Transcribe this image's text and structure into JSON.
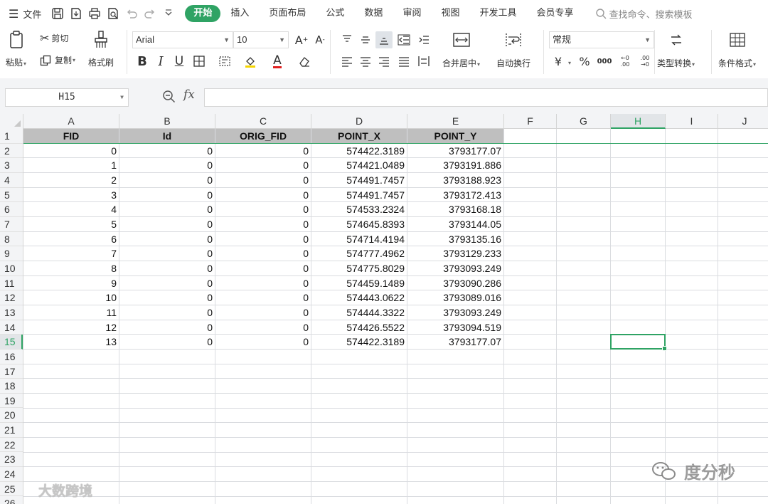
{
  "menu": {
    "file_label": "文件",
    "tabs": [
      "开始",
      "插入",
      "页面布局",
      "公式",
      "数据",
      "审阅",
      "视图",
      "开发工具",
      "会员专享"
    ],
    "active_tab": "开始",
    "search_placeholder": "查找命令、搜索模板"
  },
  "ribbon": {
    "paste": "粘贴",
    "cut": "剪切",
    "copy": "复制",
    "format_painter": "格式刷",
    "font_name": "Arial",
    "font_size": "10",
    "merge_center": "合并居中",
    "wrap_text": "自动换行",
    "number_format": "常规",
    "type_convert": "类型转换",
    "conditional_format": "条件格式",
    "currency_symbol": "¥",
    "percent_symbol": "%",
    "thousands_symbol": "000",
    "inc_decimal": "←0 .00",
    "dec_decimal": ".00 →0"
  },
  "formula_bar": {
    "name_box": "H15",
    "fx_label": "fx",
    "formula": ""
  },
  "sheet": {
    "columns": [
      "A",
      "B",
      "C",
      "D",
      "E",
      "F",
      "G",
      "H",
      "I",
      "J"
    ],
    "selected_column": "H",
    "selected_cell": "H15",
    "row_numbers": [
      "1",
      "2",
      "3",
      "4",
      "5",
      "6",
      "7",
      "8",
      "9",
      "10",
      "11",
      "12",
      "13",
      "14",
      "15",
      "16",
      "17",
      "18",
      "19",
      "20",
      "21",
      "22",
      "23",
      "24",
      "25",
      "26"
    ],
    "headers": [
      "FID",
      "Id",
      "ORIG_FID",
      "POINT_X",
      "POINT_Y"
    ],
    "rows": [
      [
        "0",
        "0",
        "0",
        "574422.3189",
        "3793177.07"
      ],
      [
        "1",
        "0",
        "0",
        "574421.0489",
        "3793191.886"
      ],
      [
        "2",
        "0",
        "0",
        "574491.7457",
        "3793188.923"
      ],
      [
        "3",
        "0",
        "0",
        "574491.7457",
        "3793172.413"
      ],
      [
        "4",
        "0",
        "0",
        "574533.2324",
        "3793168.18"
      ],
      [
        "5",
        "0",
        "0",
        "574645.8393",
        "3793144.05"
      ],
      [
        "6",
        "0",
        "0",
        "574714.4194",
        "3793135.16"
      ],
      [
        "7",
        "0",
        "0",
        "574777.4962",
        "3793129.233"
      ],
      [
        "8",
        "0",
        "0",
        "574775.8029",
        "3793093.249"
      ],
      [
        "9",
        "0",
        "0",
        "574459.1489",
        "3793090.286"
      ],
      [
        "10",
        "0",
        "0",
        "574443.0622",
        "3793089.016"
      ],
      [
        "11",
        "0",
        "0",
        "574444.3322",
        "3793093.249"
      ],
      [
        "12",
        "0",
        "0",
        "574426.5522",
        "3793094.519"
      ],
      [
        "13",
        "0",
        "0",
        "574422.3189",
        "3793177.07"
      ]
    ]
  },
  "watermarks": {
    "right": "度分秒",
    "left": "大数跨境"
  }
}
